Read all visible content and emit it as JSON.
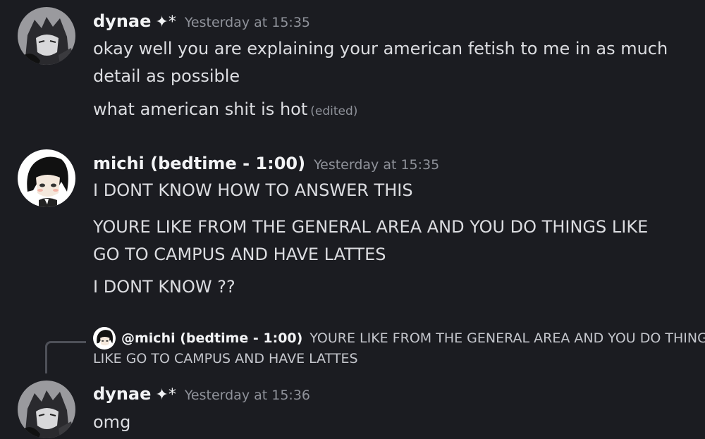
{
  "messages": [
    {
      "username": "dynae",
      "badge": "✦*",
      "timestamp": "Yesterday at 15:35",
      "lines": [
        "okay well you are explaining your american fetish to me in as much",
        "detail as possible",
        "what american shit is hot"
      ],
      "edited_label": "(edited)"
    },
    {
      "username": "michi (bedtime - 1:00)",
      "timestamp": "Yesterday at 15:35",
      "lines": [
        "I DONT KNOW HOW TO ANSWER THIS",
        "YOURE LIKE FROM THE GENERAL AREA AND YOU DO THINGS LIKE",
        "GO TO CAMPUS AND HAVE LATTES",
        "I DONT KNOW ??"
      ]
    },
    {
      "reply": {
        "mention": "@michi (bedtime - 1:00)",
        "line1": "YOURE LIKE FROM THE GENERAL AREA AND YOU DO THINGS",
        "line2": "LIKE GO TO CAMPUS AND HAVE LATTES"
      },
      "username": "dynae",
      "badge": "✦*",
      "timestamp": "Yesterday at 15:36",
      "lines": [
        "omg"
      ]
    }
  ]
}
